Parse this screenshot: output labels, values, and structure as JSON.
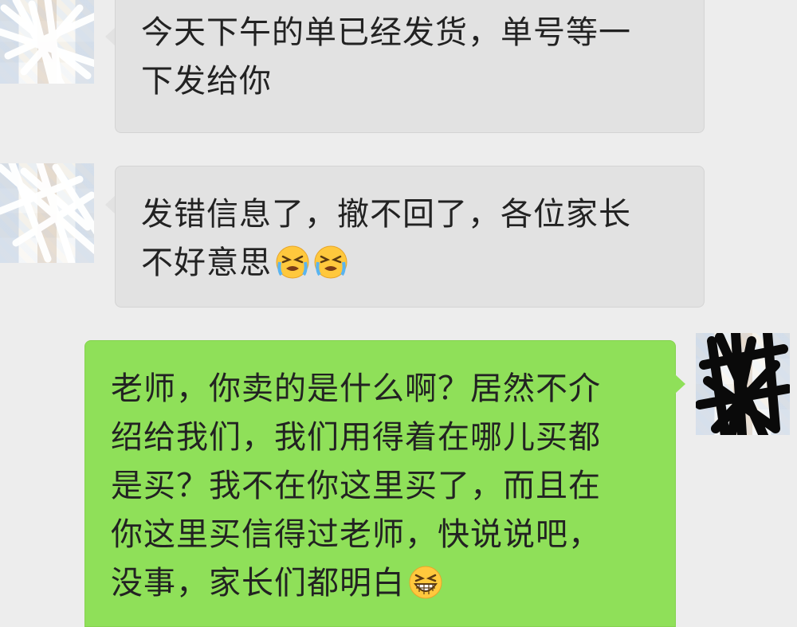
{
  "messages": [
    {
      "direction": "incoming",
      "lines": [
        "今天下午的单已经发货，单号等一",
        "下发给你"
      ]
    },
    {
      "direction": "incoming",
      "lines": [
        "发错信息了，撤不回了，各位家长",
        "不好意思"
      ],
      "trailing_emojis": [
        "loudly-crying-face",
        "loudly-crying-face"
      ]
    },
    {
      "direction": "outgoing",
      "lines": [
        "老师，你卖的是什么啊？居然不介",
        "绍给我们，我们用得着在哪儿买都",
        "是买？我不在你这里买了，而且在",
        "你这里买信得过老师，快说说吧，",
        "没事，家长们都明白"
      ],
      "trailing_emojis": [
        "grinning-squinting-face"
      ]
    }
  ],
  "colors": {
    "background": "#ededed",
    "incoming_bubble": "#e2e2e2",
    "outgoing_bubble": "#8fe059"
  }
}
